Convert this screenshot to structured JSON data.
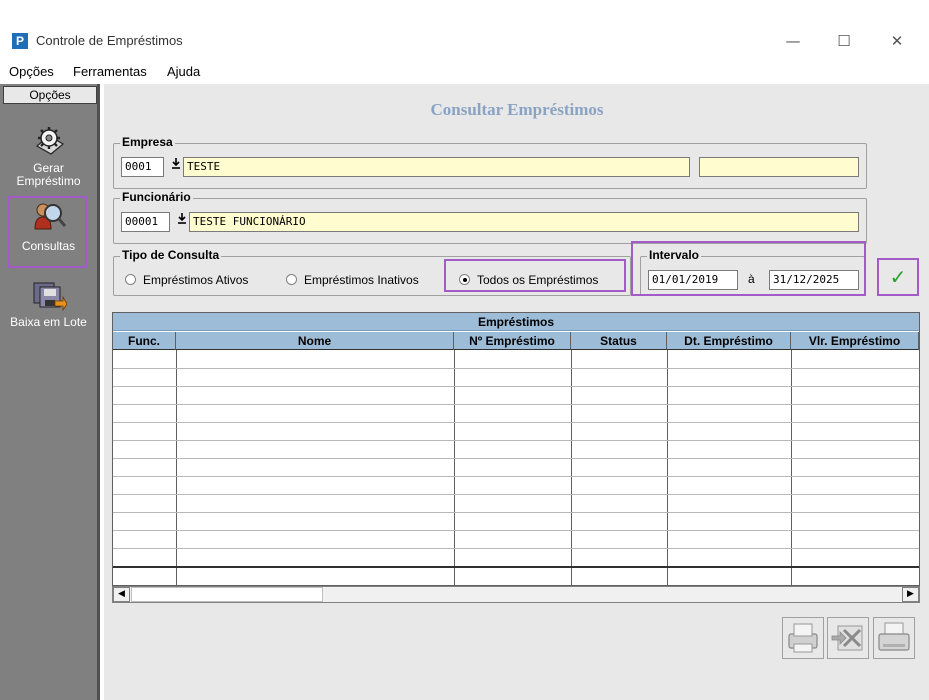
{
  "window": {
    "app_icon": "P",
    "title": "Controle de Empréstimos",
    "minimize": "—",
    "maximize": "☐",
    "close": "✕"
  },
  "menu": [
    "Opções",
    "Ferramentas",
    "Ajuda"
  ],
  "sidebar": {
    "header": "Opções",
    "items": [
      {
        "label": "Gerar Empréstimo",
        "icon": "gear-money-icon"
      },
      {
        "label": "Consultas",
        "icon": "magnifier-user-icon"
      },
      {
        "label": "Baixa em Lote",
        "icon": "batch-save-icon"
      }
    ]
  },
  "main": {
    "title": "Consultar Empréstimos",
    "empresa": {
      "label": "Empresa",
      "code": "0001",
      "name": "TESTE",
      "extra": ""
    },
    "funcionario": {
      "label": "Funcionário",
      "code": "00001",
      "name": "TESTE FUNCIONÁRIO"
    },
    "tipo": {
      "label": "Tipo de Consulta",
      "options": [
        {
          "label": "Empréstimos Ativos",
          "selected": false
        },
        {
          "label": "Empréstimos Inativos",
          "selected": false
        },
        {
          "label": "Todos os Empréstimos",
          "selected": true
        }
      ]
    },
    "intervalo": {
      "label": "Intervalo",
      "start": "01/01/2019",
      "sep": "à",
      "end": "31/12/2025"
    },
    "confirm_glyph": "✓"
  },
  "grid": {
    "caption": "Empréstimos",
    "columns": [
      "Func.",
      "Nome",
      "Nº Empréstimo",
      "Status",
      "Dt. Empréstimo",
      "Vlr. Empréstimo"
    ]
  },
  "scroll": {
    "left": "◀",
    "right": "▶"
  }
}
